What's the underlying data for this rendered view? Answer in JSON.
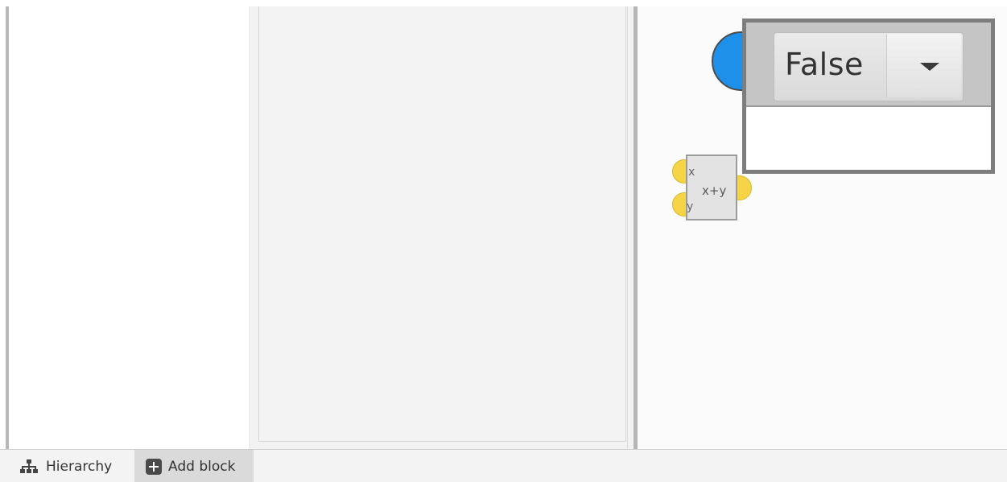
{
  "popup": {
    "selected_value": "False",
    "dropdown_icon": "triangle-down-icon"
  },
  "add_block": {
    "input_x": "x",
    "input_y": "y",
    "operation": "x+y"
  },
  "bottom_tabs": [
    {
      "label": "Hierarchy",
      "icon": "hierarchy-icon"
    },
    {
      "label": "Add block",
      "icon": "plus-square-icon"
    }
  ],
  "colors": {
    "node_blue": "#1e90e9",
    "port_yellow": "#f5d547"
  }
}
